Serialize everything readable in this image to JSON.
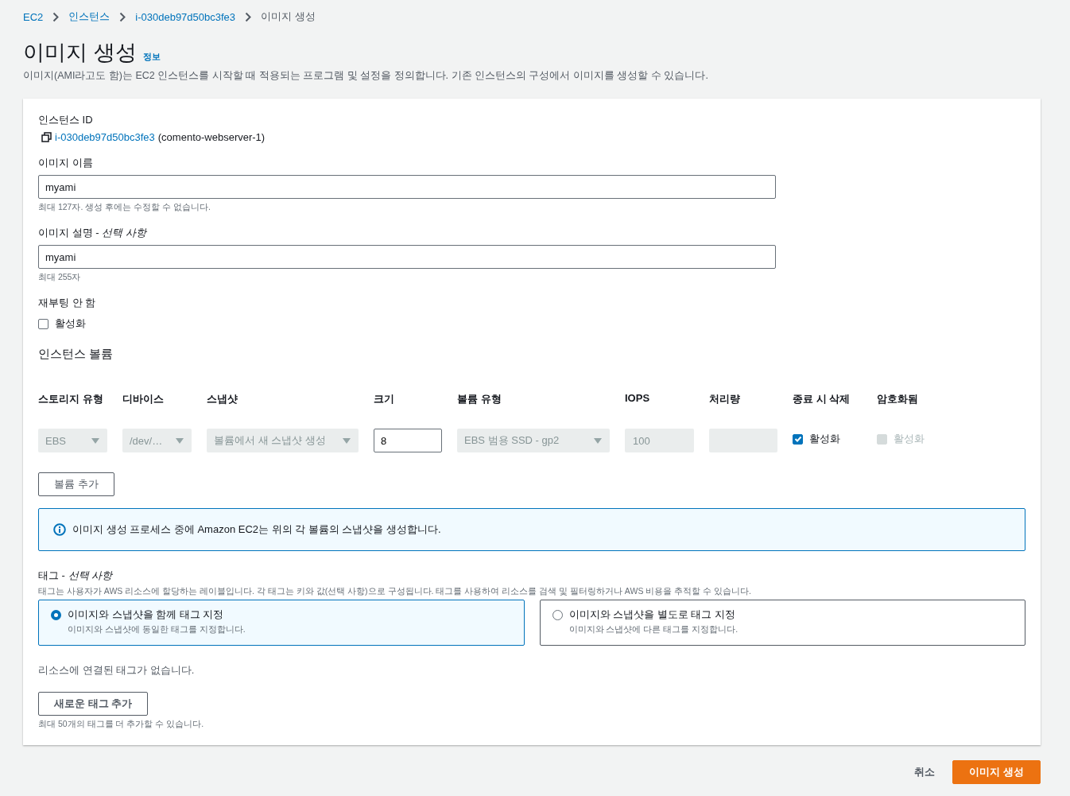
{
  "breadcrumb": [
    {
      "label": "EC2",
      "link": true
    },
    {
      "label": "인스턴스",
      "link": true
    },
    {
      "label": "i-030deb97d50bc3fe3",
      "link": true
    },
    {
      "label": "이미지 생성",
      "link": false
    }
  ],
  "title": "이미지 생성",
  "info_link": "정보",
  "description": "이미지(AMI라고도 함)는 EC2 인스턴스를 시작할 때 적용되는 프로그램 및 설정을 정의합니다. 기존 인스턴스의 구성에서 이미지를 생성할 수 있습니다.",
  "instance": {
    "label": "인스턴스 ID",
    "id": "i-030deb97d50bc3fe3",
    "name": "(comento-webserver-1)"
  },
  "image_name": {
    "label": "이미지 이름",
    "value": "myami",
    "hint": "최대 127자. 생성 후에는 수정할 수 없습니다."
  },
  "image_description": {
    "label": "이미지 설명 - *선택 사항*",
    "value": "myami",
    "hint": "최대 255자"
  },
  "no_reboot": {
    "label": "재부팅 안 함",
    "option": "활성화",
    "checked": false
  },
  "volumes": {
    "title": "인스턴스 볼륨",
    "columns": [
      "스토리지 유형",
      "디바이스",
      "스냅샷",
      "크기",
      "볼륨 유형",
      "IOPS",
      "처리량",
      "종료 시 삭제",
      "암호화됨"
    ],
    "row": [
      {
        "kind": "select",
        "value": "EBS"
      },
      {
        "kind": "select",
        "value": "/dev/…"
      },
      {
        "kind": "select",
        "value": "볼륨에서 새 스냅샷 생성"
      },
      {
        "kind": "input",
        "value": "8"
      },
      {
        "kind": "select",
        "value": "EBS 범용 SSD - gp2"
      },
      {
        "kind": "readonly",
        "value": "100"
      },
      {
        "kind": "readonly"
      },
      {
        "kind": "checkbox",
        "label": "활성화",
        "checked": true,
        "disabled": false
      },
      {
        "kind": "checkbox",
        "label": "활성화",
        "checked": false,
        "disabled": true
      }
    ],
    "add_button": "볼륨 추가"
  },
  "info_alert": "이미지 생성 프로세스 중에 Amazon EC2는 위의 각 볼륨의 스냅샷을 생성합니다.",
  "tags": {
    "label": "태그 - *선택 사항*",
    "description": "태그는 사용자가 AWS 리소스에 할당하는 레이블입니다. 각 태그는 키와 값(선택 사항)으로 구성됩니다. 태그를 사용하여 리소스를 검색 및 필터링하거나 AWS 비용을 추적할 수 있습니다.",
    "options": [
      {
        "title": "이미지와 스냅샷을 함께 태그 지정",
        "subtitle": "이미지와 스냅샷에 동일한 태그를 지정합니다.",
        "selected": true
      },
      {
        "title": "이미지와 스냅샷을 별도로 태그 지정",
        "subtitle": "이미지와 스냅샷에 다른 태그를 지정합니다.",
        "selected": false
      }
    ],
    "empty": "리소스에 연결된 태그가 없습니다.",
    "add_button": "새로운 태그 추가",
    "limit": "최대 50개의 태그를 더 추가할 수 있습니다."
  },
  "footer": {
    "cancel": "취소",
    "submit": "이미지 생성"
  }
}
